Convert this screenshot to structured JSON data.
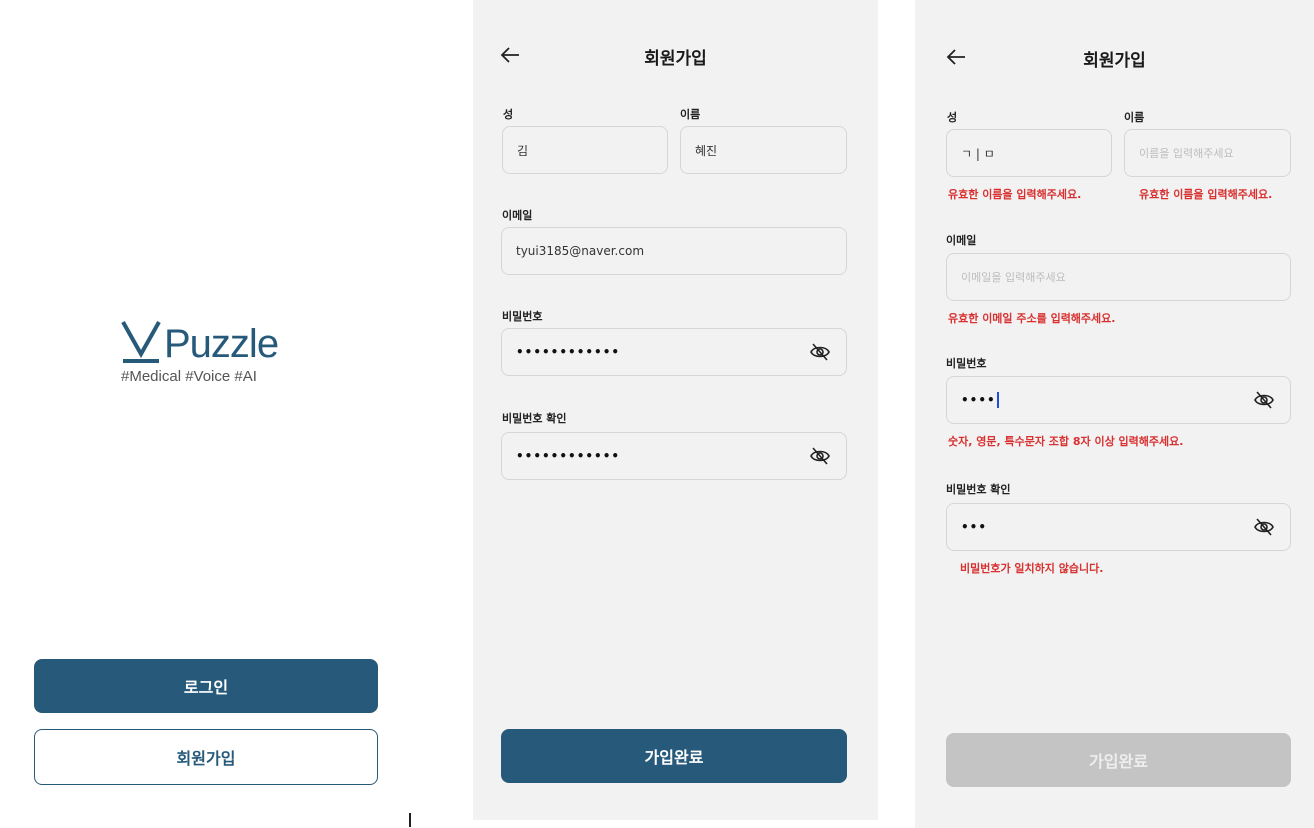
{
  "landing": {
    "logo_wordmark": "Puzzle",
    "tagline": "#Medical #Voice #AI",
    "login_label": "로그인",
    "signup_label": "회원가입",
    "brand_color": "#275a7a"
  },
  "signup_filled": {
    "title": "회원가입",
    "last_name_label": "성",
    "last_name_value": "김",
    "first_name_label": "이름",
    "first_name_value": "혜진",
    "email_label": "이메일",
    "email_value": "tyui3185@naver.com",
    "password_label": "비밀번호",
    "password_value": "••••••••••••",
    "password_confirm_label": "비밀번호 확인",
    "password_confirm_value": "••••••••••••",
    "submit_label": "가입완료"
  },
  "signup_errors": {
    "title": "회원가입",
    "last_name_label": "성",
    "last_name_value": "ㄱ | ㅁ",
    "last_name_error": "유효한 이름을 입력해주세요.",
    "first_name_label": "이름",
    "first_name_placeholder": "이름을 입력해주세요",
    "first_name_error": "유효한 이름을 입력해주세요.",
    "email_label": "이메일",
    "email_placeholder": "이메일을 입력해주세요",
    "email_error": "유효한 이메일 주소를 입력해주세요.",
    "password_label": "비밀번호",
    "password_value": "••••",
    "password_error": "숫자, 영문, 특수문자 조합 8자 이상 입력해주세요.",
    "password_confirm_label": "비밀번호 확인",
    "password_confirm_value": "•••",
    "password_confirm_error": "비밀번호가 일치하지 않습니다.",
    "submit_label": "가입완료",
    "error_color": "#d93030"
  }
}
